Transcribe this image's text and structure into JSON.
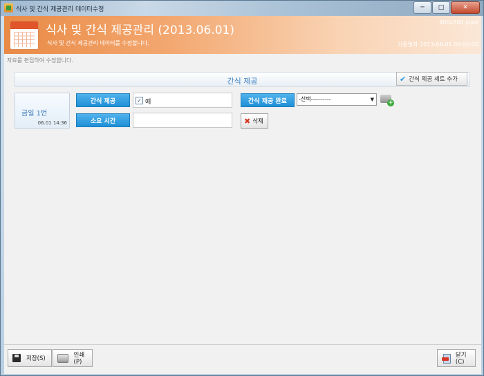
{
  "window": {
    "title": "식사 및 간식 제공관리 데이터수정",
    "min_glyph": "─",
    "max_glyph": "□",
    "close_glyph": "✕"
  },
  "banner": {
    "title": "식사 및 간식 제공관리 (2013.06.01)",
    "subtitle": "식사 및 간식 제공관리 데이터를 수정합니다.",
    "size_label": "900x700 pixel",
    "date_label": "기준일자:2013-06-01 00:00:00"
  },
  "content": {
    "edit_note": "자료를 편집하여 수정합니다.",
    "section_title": "간식 제공",
    "add_set_label": "간식 제공 세트 추가"
  },
  "day_card": {
    "label": "금일 1번",
    "time": "06.01 14:36"
  },
  "form": {
    "snack_provided_label": "간식 제공",
    "snack_checkbox_label": "예",
    "snack_checked_glyph": "✓",
    "duration_label": "소요 시간",
    "duration_value": "",
    "completion_label": "간식 제공 완료",
    "completion_selected": "-선택----------",
    "delete_label": "삭제"
  },
  "footer": {
    "save_label": "저장(S)",
    "print_label": "인쇄(P)",
    "close_label": "닫기(C)"
  },
  "icons": {
    "check": "✔",
    "delete": "✖",
    "dropdown": "▼",
    "plus": "+"
  }
}
